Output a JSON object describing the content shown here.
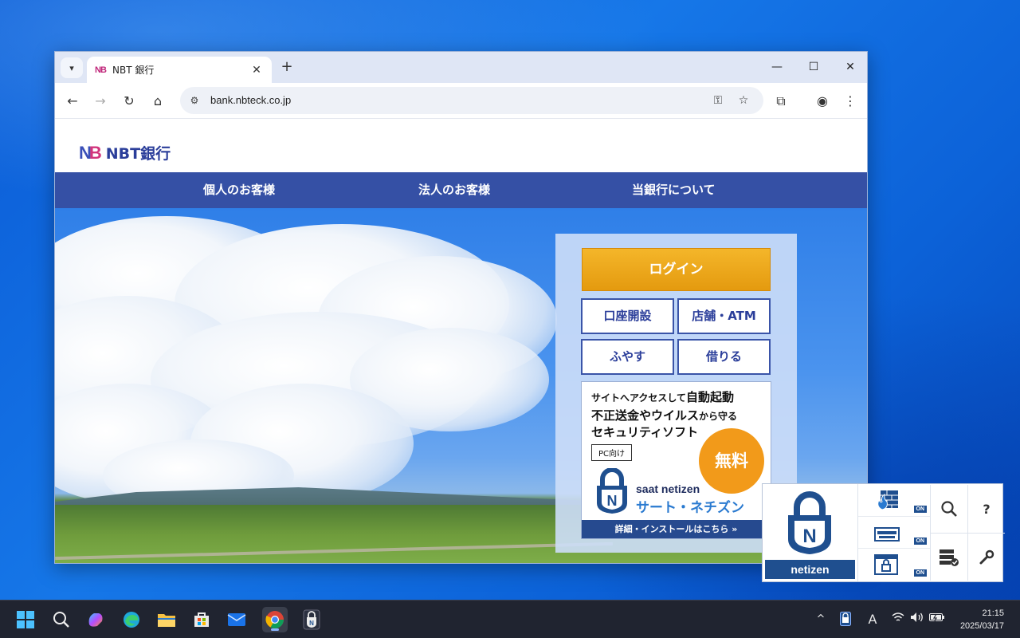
{
  "browser": {
    "tab_title": "NBT 銀行",
    "tab_favicon": "NB",
    "tab_close": "✕",
    "new_tab": "+",
    "url": "bank.nbteck.co.jp",
    "controls": {
      "minimize": "—",
      "maximize": "☐",
      "close": "✕"
    }
  },
  "page": {
    "logo_mark_n": "N",
    "logo_mark_b": "B",
    "logo_text": "NBT銀行",
    "nav": [
      "個人のお客様",
      "法人のお客様",
      "当銀行について"
    ],
    "panel": {
      "login": "ログイン",
      "buttons": [
        "口座開設",
        "店舗・ATM",
        "ふやす",
        "借りる"
      ]
    },
    "ad": {
      "line1a": "サイトへアクセスして",
      "line1b": "自動起動",
      "line2a": "不正送金やウイルス",
      "line2b": "から守る",
      "line3": "セキュリティソフト",
      "pc_label": "PC向け",
      "free_badge": "無料",
      "brand_en": "saat netizen",
      "brand_ja": "サート・ネチズン",
      "footer": "詳細・インストールはこちら »"
    }
  },
  "netizen_widget": {
    "label": "netizen",
    "on_label": "ON",
    "help": "?"
  },
  "taskbar": {
    "clock_time": "21:15",
    "clock_date": "2025/03/17",
    "ime": "A",
    "chevron": "^"
  },
  "colors": {
    "nav_bg": "#3550a5",
    "login_orange": "#e9a417",
    "brand_blue": "#2b3e9a",
    "brand_pink": "#d2357c"
  }
}
